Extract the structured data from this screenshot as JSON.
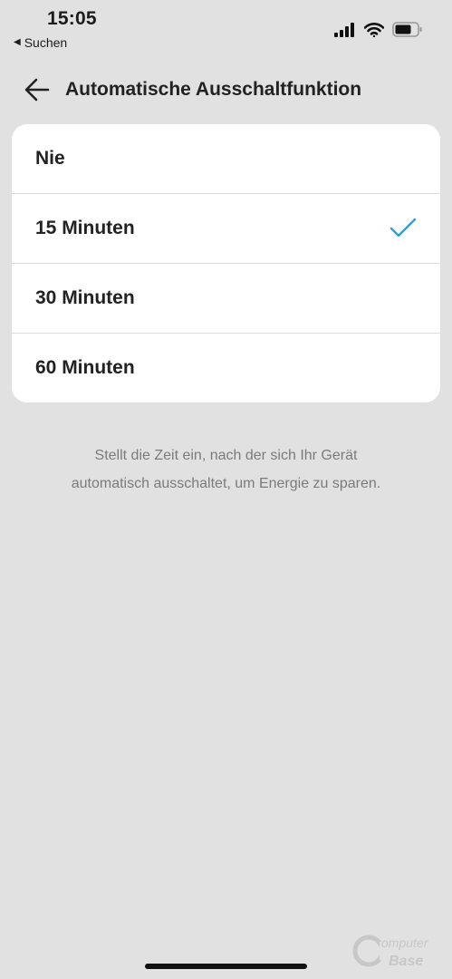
{
  "status_bar": {
    "time": "15:05",
    "back_app": "Suchen",
    "icons": [
      "cellular-signal-icon",
      "wifi-icon",
      "battery-icon"
    ]
  },
  "header": {
    "title": "Automatische Ausschaltfunktion",
    "back_icon": "arrow-left-icon"
  },
  "options": [
    {
      "label": "Nie",
      "selected": false
    },
    {
      "label": "15 Minuten",
      "selected": true
    },
    {
      "label": "30 Minuten",
      "selected": false
    },
    {
      "label": "60 Minuten",
      "selected": false
    }
  ],
  "description": "Stellt die Zeit ein, nach der sich Ihr Gerät automatisch ausschaltet, um Energie zu sparen.",
  "watermark": "ComputerBase",
  "colors": {
    "background": "#e1e1e1",
    "card": "#ffffff",
    "accent": "#2a9fd6",
    "secondary_text": "#7b7b7b"
  }
}
